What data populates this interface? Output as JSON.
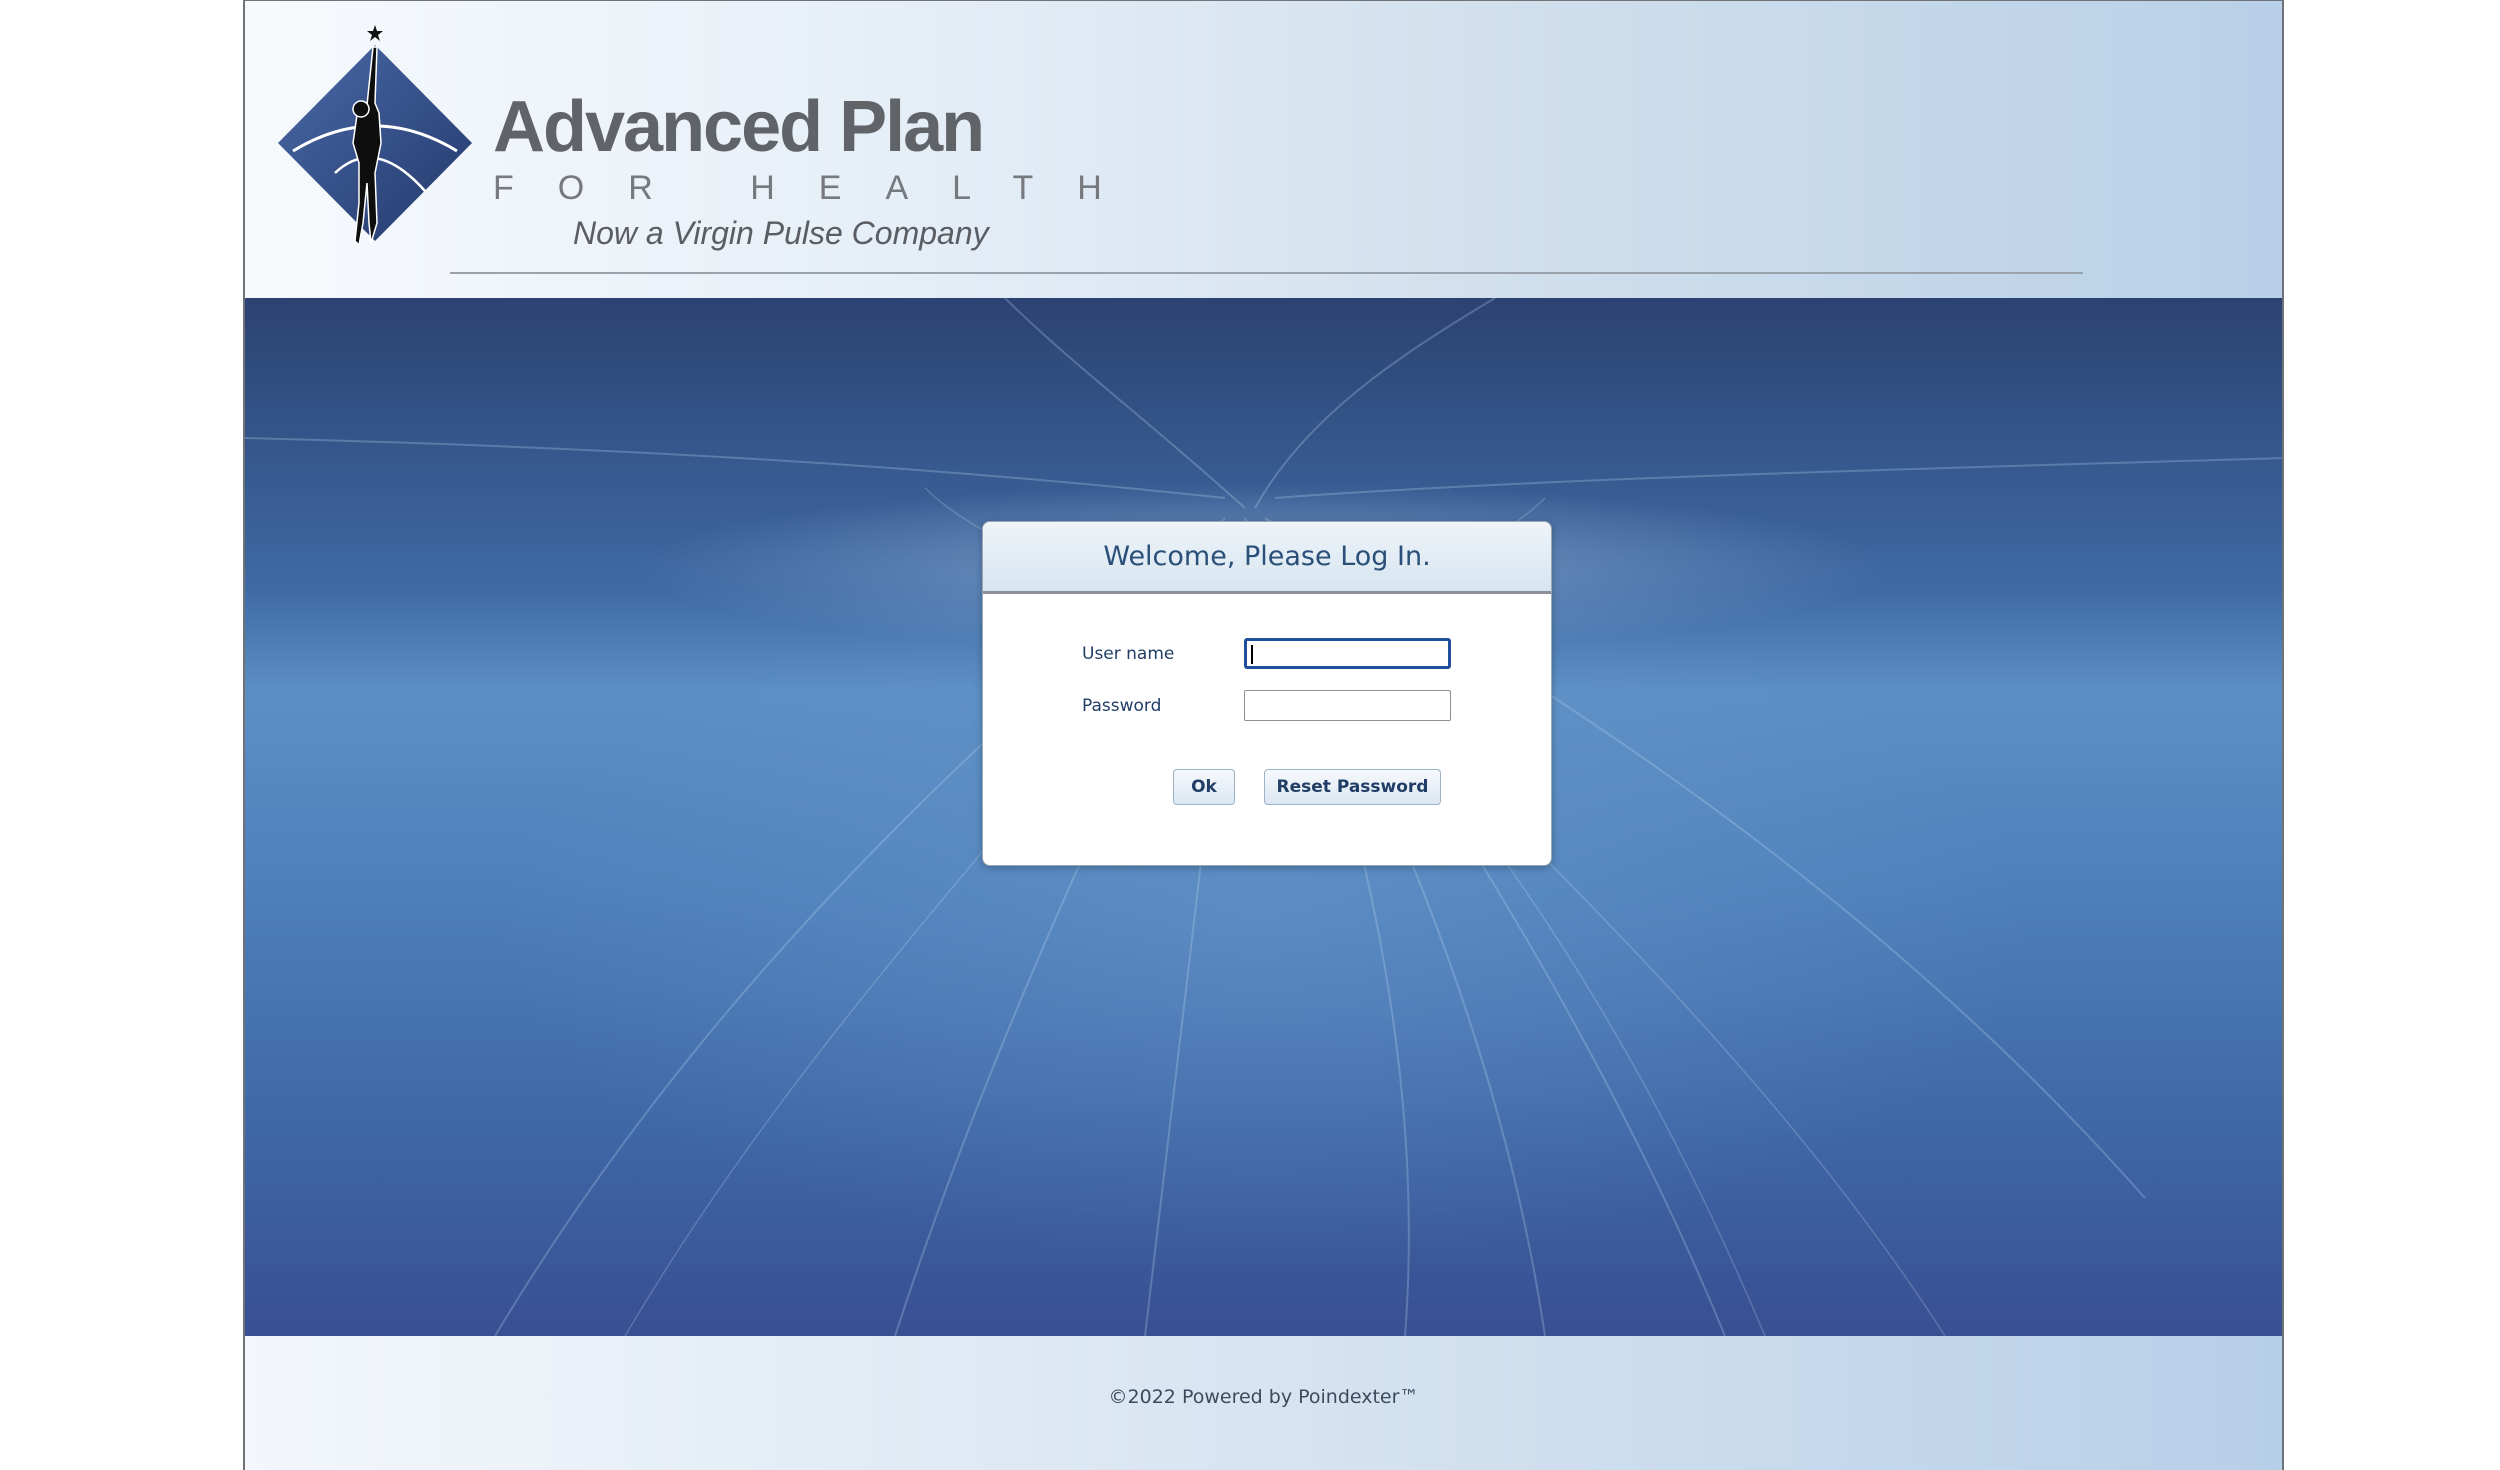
{
  "brand": {
    "name": "Advanced Plan",
    "sub": "FOR HEALTH",
    "tagline": "Now a Virgin Pulse Company"
  },
  "login": {
    "title": "Welcome, Please Log In.",
    "username_label": "User name",
    "username_value": "",
    "password_label": "Password",
    "password_value": "",
    "ok_label": "Ok",
    "reset_label": "Reset Password"
  },
  "footer": {
    "text": "©2022 Powered by Poindexter™"
  },
  "colors": {
    "logo_diamond": "#34548f",
    "title_text": "#2a4f78",
    "focus_ring": "#1f4f9a"
  }
}
